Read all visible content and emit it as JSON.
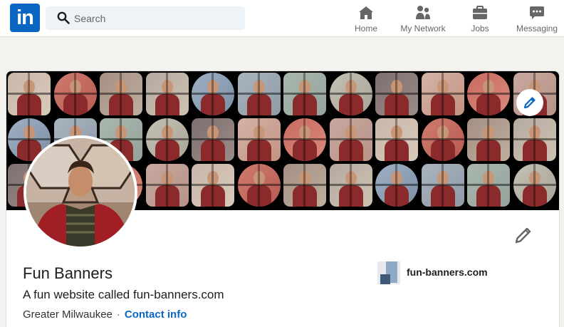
{
  "nav": {
    "logo_text": "in",
    "search_placeholder": "Search",
    "items": [
      {
        "label": "Home",
        "icon": "home-icon"
      },
      {
        "label": "My Network",
        "icon": "network-icon"
      },
      {
        "label": "Jobs",
        "icon": "briefcase-icon"
      },
      {
        "label": "Messaging",
        "icon": "messaging-icon"
      }
    ]
  },
  "profile": {
    "name": "Fun Banners",
    "headline": "A fun website called fun-banners.com",
    "location": "Greater Milwaukee",
    "separator": "·",
    "contact_label": "Contact info",
    "website": "fun-banners.com"
  },
  "colors": {
    "brand": "#0a66c2",
    "page_bg": "#f3f2ef",
    "banner_bg": "#000000"
  }
}
